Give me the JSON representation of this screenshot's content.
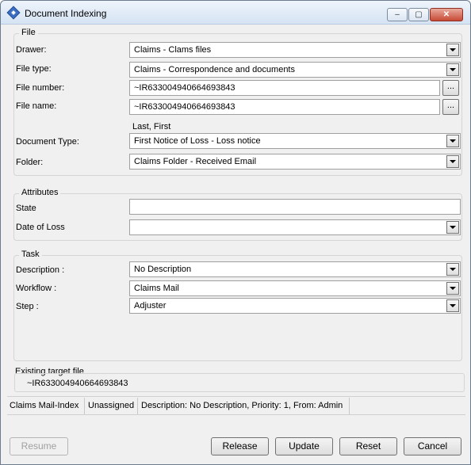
{
  "window": {
    "title": "Document Indexing",
    "minimize_glyph": "–",
    "maximize_glyph": "▢",
    "close_glyph": "✕"
  },
  "file_group": {
    "label": "File",
    "drawer": {
      "label": "Drawer:",
      "value": "Claims - Clams files"
    },
    "file_type": {
      "label": "File type:",
      "value": "Claims - Correspondence and documents"
    },
    "file_number": {
      "label": "File number:",
      "value": "~IR633004940664693843",
      "browse_label": "..."
    },
    "file_name": {
      "label": "File name:",
      "value": "~IR633004940664693843",
      "browse_label": "...",
      "hint": "Last, First"
    },
    "document_type": {
      "label": "Document Type:",
      "value": "First Notice of Loss - Loss notice"
    },
    "folder": {
      "label": "Folder:",
      "value": "Claims Folder - Received Email"
    }
  },
  "attributes_group": {
    "label": "Attributes",
    "state": {
      "label": "State",
      "value": ""
    },
    "date_of_loss": {
      "label": "Date of Loss",
      "value": ""
    }
  },
  "task_group": {
    "label": "Task",
    "description": {
      "label": "Description :",
      "value": "No Description"
    },
    "workflow": {
      "label": "Workflow :",
      "value": "Claims Mail"
    },
    "step": {
      "label": "Step :",
      "value": "Adjuster"
    }
  },
  "existing_target": {
    "label": "Existing target file",
    "value": "~IR633004940664693843"
  },
  "status_bar": {
    "queue": "Claims Mail-Index",
    "assignment": "Unassigned",
    "details": "Description: No Description, Priority: 1, From: Admin"
  },
  "buttons": {
    "resume": "Resume",
    "release": "Release",
    "update": "Update",
    "reset": "Reset",
    "cancel": "Cancel"
  },
  "icons": {
    "app": "document-indexing-icon",
    "dropdown": "chevron-down-icon"
  }
}
